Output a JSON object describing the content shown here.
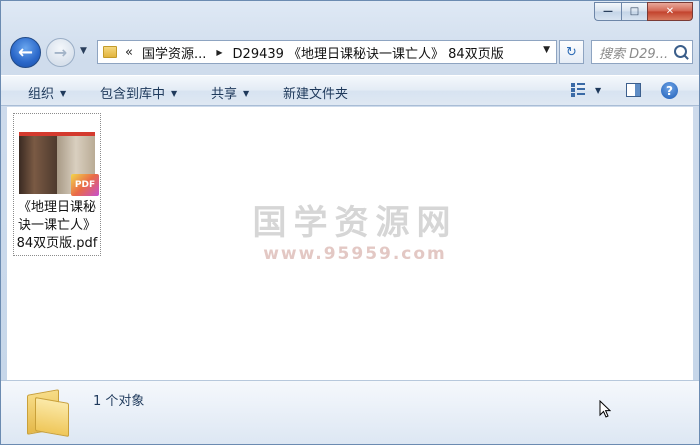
{
  "window": {
    "caption_buttons": {
      "minimize": "—",
      "maximize": "□",
      "close": "✕"
    }
  },
  "nav": {
    "back_icon": "back-arrow-icon",
    "forward_icon": "forward-arrow-icon",
    "address": {
      "overflow": "«",
      "segments": [
        "国学资源...",
        "D29439 《地理日课秘诀一课亡人》 84双页版"
      ]
    },
    "search_placeholder": "搜索 D29..."
  },
  "toolbar": {
    "organize": "组织",
    "include_library": "包含到库中",
    "share": "共享",
    "new_folder": "新建文件夹"
  },
  "files": [
    {
      "name_line1": "《地理日课秘",
      "name_line2": "诀一课亡人》",
      "name_line3": "84双页版.pdf",
      "badge": "PDF"
    }
  ],
  "watermark": {
    "title": "国学资源网",
    "url": "www.95959.com"
  },
  "status": {
    "text": "1 个对象"
  },
  "colors": {
    "accent": "#2a67c9",
    "pdf_red": "#d43a2e"
  }
}
